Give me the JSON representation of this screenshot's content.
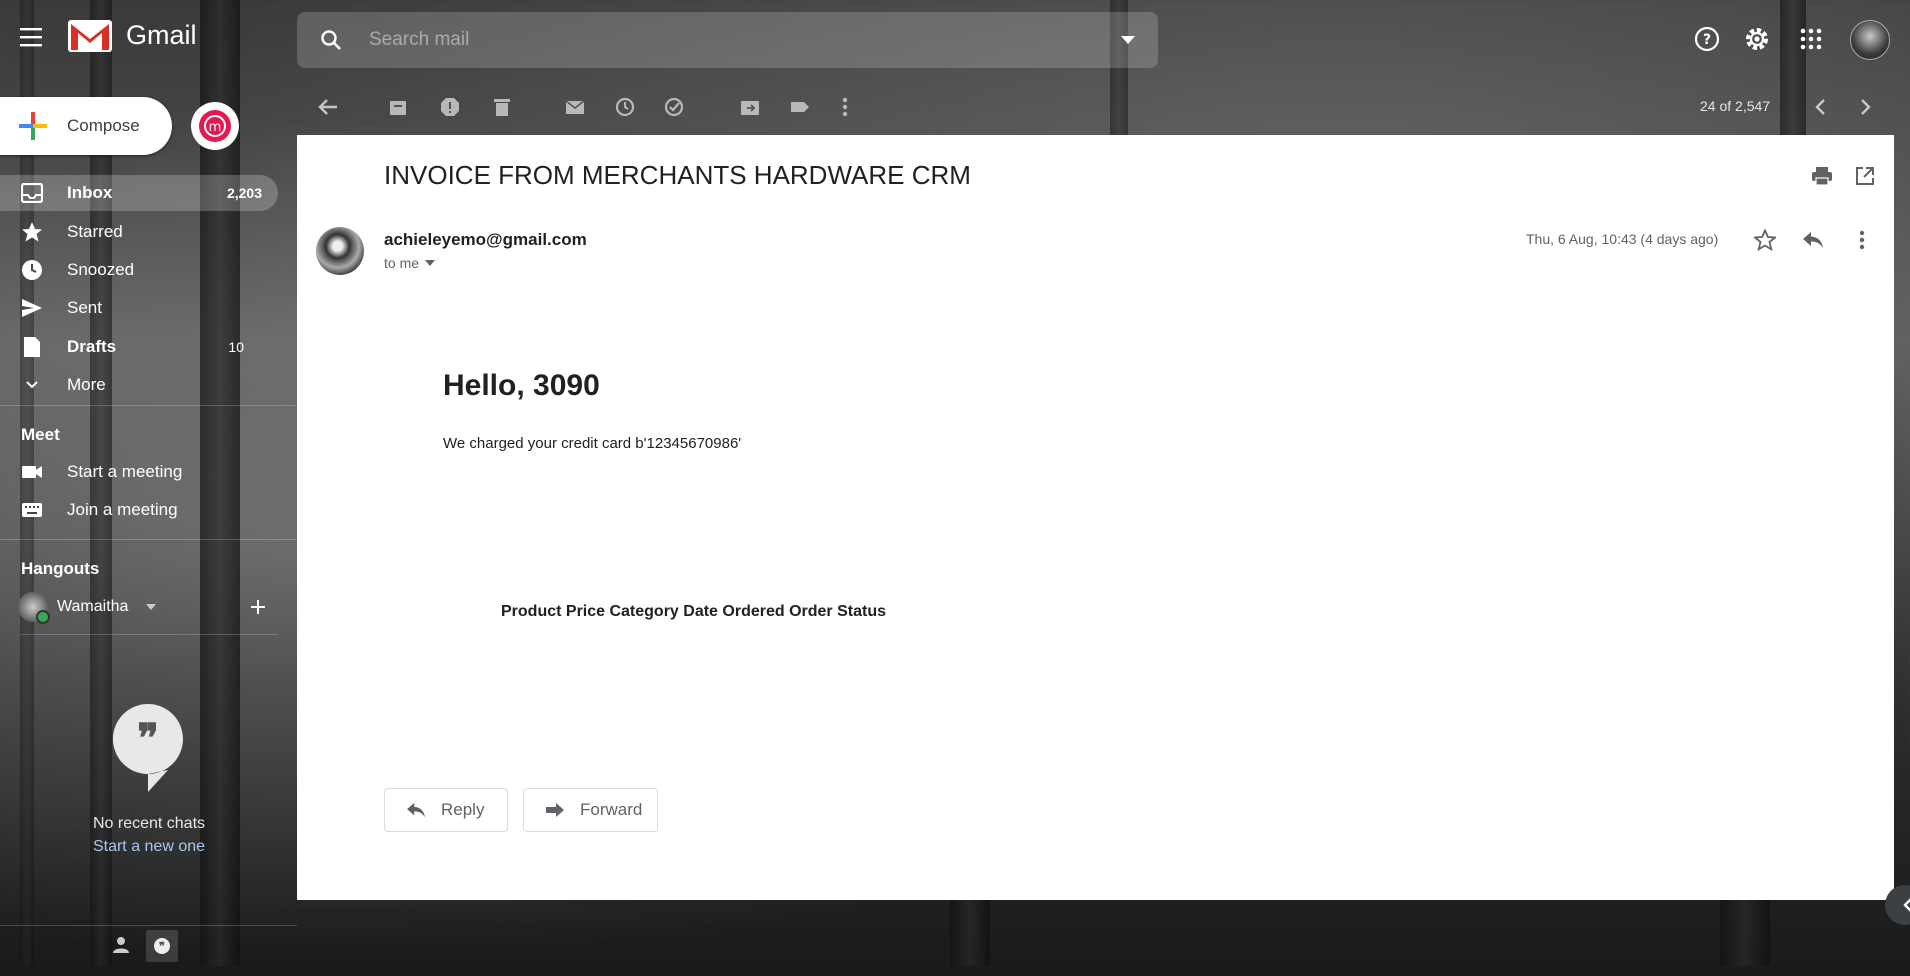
{
  "app": {
    "name": "Gmail"
  },
  "search": {
    "placeholder": "Search mail"
  },
  "toolbar": {
    "pager": "24 of 2,547"
  },
  "sidebar": {
    "compose_label": "Compose",
    "items": [
      {
        "label": "Inbox",
        "count": "2,203",
        "icon": "inbox-icon"
      },
      {
        "label": "Starred",
        "count": "",
        "icon": "star-icon"
      },
      {
        "label": "Snoozed",
        "count": "",
        "icon": "clock-icon"
      },
      {
        "label": "Sent",
        "count": "",
        "icon": "send-icon"
      },
      {
        "label": "Drafts",
        "count": "10",
        "icon": "draft-icon"
      },
      {
        "label": "More",
        "count": "",
        "icon": "chevron-down-icon"
      }
    ],
    "meet": {
      "title": "Meet",
      "items": [
        {
          "label": "Start a meeting"
        },
        {
          "label": "Join a meeting"
        }
      ]
    },
    "hangouts": {
      "title": "Hangouts",
      "user": "Wamaitha",
      "no_chats": "No recent chats",
      "start_new": "Start a new one"
    }
  },
  "message": {
    "subject": "INVOICE FROM MERCHANTS HARDWARE CRM",
    "sender": "achieleyemo@gmail.com",
    "to": "to me",
    "date": "Thu, 6 Aug, 10:43 (4 days ago)",
    "body": {
      "greeting": "Hello, 3090",
      "text": "We charged your credit card b'12345670986'",
      "table_header": "Product Price Category Date Ordered Order Status"
    },
    "reply_label": "Reply",
    "forward_label": "Forward"
  },
  "colors": {
    "brand_red": "#d93025",
    "accent_blue": "#a7c6ee",
    "online_green": "#34a853"
  }
}
